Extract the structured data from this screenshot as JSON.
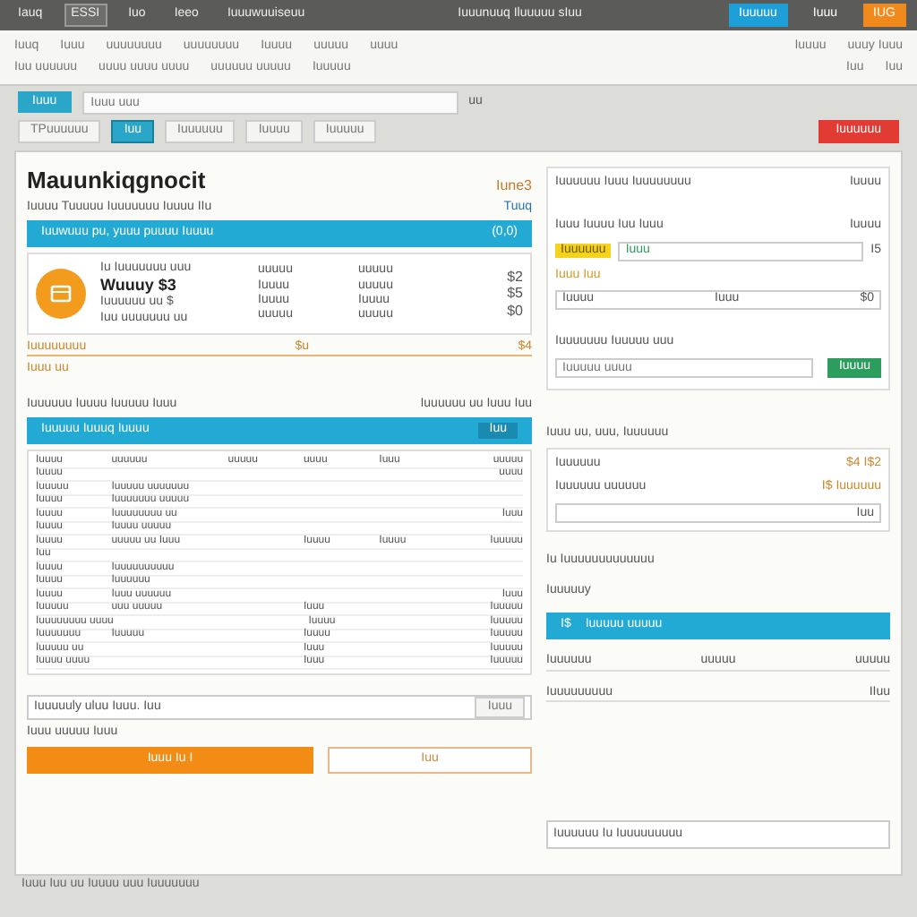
{
  "top_bar": {
    "tabs": [
      {
        "label": "Iauq",
        "selected": false
      },
      {
        "label": "ESSI",
        "selected": true
      },
      {
        "label": "Iuo",
        "selected": false
      },
      {
        "label": "Ieeo",
        "selected": false
      },
      {
        "label": "Iuuuwuuiseuu",
        "selected": false
      }
    ],
    "title": "Iuuunuuq Iluuuuu sIuu",
    "actions": [
      {
        "label": "Iuuuuu",
        "kind": "primary"
      },
      {
        "label": "Iuuu",
        "kind": "plain"
      },
      {
        "label": "IUG",
        "kind": "accent"
      }
    ]
  },
  "toolbar": {
    "row_1": [
      "Iuuq",
      "Iuuu",
      "uuuuuuuu",
      "uuuuuuuu",
      "Iuuuu",
      "uuuuu",
      "uuuu"
    ],
    "row_1_right": [
      "Iuuuu",
      "uuuy Iuuu"
    ],
    "row_2": [
      "Iuu uuuuuu",
      "uuuu uuuu uuuu",
      "uuuuuu uuuuu",
      "Iuuuuu"
    ],
    "row_2_right": [
      "Iuu",
      "Iuu"
    ]
  },
  "search": {
    "chip": "Iuuu",
    "placeholder": "Iuuu uuu",
    "hint": "uu"
  },
  "sub_tabs": [
    {
      "label": "TPuuuuuu",
      "selected": false
    },
    {
      "label": "Iuu",
      "selected": true
    },
    {
      "label": "Iuuuuuu",
      "selected": false
    },
    {
      "label": "Iuuuu",
      "selected": false
    },
    {
      "label": "Iuuuuu",
      "selected": false
    }
  ],
  "alert_button": "Iuuuuuu",
  "summary": {
    "title": "Mauunkiqgnocit",
    "badge": "Iune3",
    "subtitle": "Iuuuu  Tuuuuu  Iuuuuuuu Iuuuu IIu",
    "link": "Tuuq",
    "banner": {
      "text": "Iuuwuuu pu, yuuu puuuu Iuuuu",
      "value": "(0,0)"
    },
    "item": {
      "caption": "Iu Iuuuuuuu uuu",
      "headline": "Wuuuy $3",
      "detail": "Iuuuuuu uu $",
      "note": "Iuu uuuuuuu uu",
      "cols": [
        [
          "uuuuu",
          "Iuuuu",
          "Iuuuu",
          "uuuuu"
        ],
        [
          "uuuuu",
          "uuuuu",
          "Iuuuu",
          "uuuuu"
        ]
      ],
      "amounts": [
        "$2",
        "$5",
        "$0"
      ],
      "total_label": "Iuuuuuuuu",
      "total_mid": "$u",
      "total": "$4"
    },
    "footnote": "Iuuu uu"
  },
  "details": {
    "caption": "Iuuuuuu Iuuuu Iuuuuu Iuuu",
    "caption_right": "Iuuuuuu uu Iuuu Iuu",
    "banner": {
      "text": "Iuuuuu Iuuuq Iuuuu",
      "button": "Iuu"
    },
    "rows": [
      [
        "Iuuuu",
        "uuuuuu",
        "uuuuu",
        "uuuu",
        "Iuuu",
        "uuuuu"
      ],
      [
        "Iuuuu",
        "",
        "",
        "",
        "",
        "uuuu"
      ],
      [
        "Iuuuuu",
        "Iuuuuu uuuuuuu",
        "",
        "",
        "",
        ""
      ],
      [
        "Iuuuu",
        "Iuuuuuuu uuuuu",
        "",
        "",
        "",
        ""
      ],
      [
        "Iuuuu",
        "Iuuuuuuuu uu",
        "",
        "",
        "",
        "Iuuu"
      ],
      [
        "Iuuuu",
        "Iuuuu uuuuu",
        "",
        "",
        "",
        ""
      ],
      [
        "Iuuuu",
        "uuuuu uu Iuuu",
        "",
        "Iuuuu",
        "Iuuuu",
        "Iuuuuu"
      ],
      [
        "Iuu",
        "",
        "",
        "",
        "",
        ""
      ],
      [
        "Iuuuu",
        "Iuuuuuuuuuu",
        "",
        "",
        "",
        ""
      ],
      [
        "Iuuuu",
        "Iuuuuuu",
        "",
        "",
        "",
        ""
      ],
      [
        "Iuuuu",
        "Iuuu uuuuuu",
        "",
        "",
        "",
        "Iuuu"
      ],
      [
        "Iuuuuu",
        "uuu uuuuu",
        "",
        "Iuuu",
        "",
        "Iuuuuu"
      ],
      [
        "Iuuuuuuuu uuuu",
        "",
        "",
        "Iuuuu",
        "",
        "Iuuuuu"
      ],
      [
        "Iuuuuuuu",
        "Iuuuuu",
        "",
        "Iuuuu",
        "",
        "Iuuuuu"
      ],
      [
        "Iuuuuu uu",
        "",
        "",
        "Iuuu",
        "",
        "Iuuuuu"
      ],
      [
        "Iuuuu uuuu",
        "",
        "",
        "Iuuu",
        "",
        "Iuuuuu"
      ]
    ],
    "field": {
      "value": "Iuuuuuly uluu Iuuu. Iuu",
      "button": "Iuuu"
    },
    "field_note": "Iuuu uuuuu Iuuu",
    "primary_button": "Iuuu Iu I",
    "secondary_button": "Iuu"
  },
  "side_card": {
    "title": "Iuuuuuu  Iuuu Iuuuuuuuu",
    "title_right": "Iuuuu",
    "line": "Iuuu Iuuuu Iuu Iuuu",
    "line_right": "Iuuuu",
    "highlight": "Iuuuuuu",
    "tag": "Iuuu",
    "tag_value": "I5",
    "small_tag": "Iuuu Iuu",
    "select": "Iuuuu",
    "select_mid": "Iuuu",
    "select_right": "$0",
    "prompt": "Iuuuuuuu Iuuuuu uuu",
    "input_placeholder": "Iuuuuu uuuu",
    "go_button": "Iuuuu"
  },
  "side_list": {
    "title": "Iuuu uu, uuu, Iuuuuuu",
    "rows": [
      {
        "label": "Iuuuuuu",
        "value": "$4 I$2"
      },
      {
        "label": "Iuuuuuu uuuuuu",
        "value": "I$ Iuuuuuu"
      }
    ],
    "input_right": "Iuu"
  },
  "side_lower": {
    "title": "Iu Iuuuuuuuuuuuuu",
    "subtitle": "Iuuuuuy",
    "banner": {
      "icon_text": "I$",
      "text": "Iuuuuu uuuuu"
    },
    "rows": [
      [
        "Iuuuuuu",
        "uuuuu",
        "uuuuu"
      ],
      [
        "Iuuuuuuuuu",
        "",
        "IIuu"
      ]
    ],
    "footer_field": "Iuuuuuu Iu Iuuuuuuuuu"
  },
  "status_bar": {
    "text": "Iuuu Iuu  uu  Iuuuu uuu  Iuuuuuuu"
  }
}
